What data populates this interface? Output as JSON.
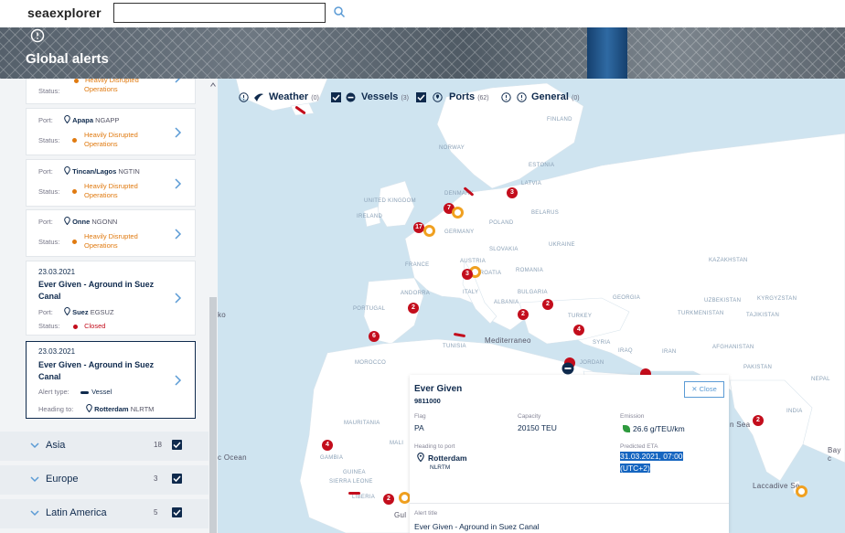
{
  "header": {
    "logo": "seaexplorer",
    "search_placeholder": ""
  },
  "hero": {
    "title": "Global alerts"
  },
  "sidebar": {
    "cards": [
      {
        "status_label": "Status:",
        "status": "Heavily Disrupted Operations"
      },
      {
        "port_label": "Port:",
        "port": "Apapa",
        "code": "NGAPP",
        "status_label": "Status:",
        "status": "Heavily Disrupted Operations"
      },
      {
        "port_label": "Port:",
        "port": "Tincan/Lagos",
        "code": "NGTIN",
        "status_label": "Status:",
        "status": "Heavily Disrupted Operations"
      },
      {
        "port_label": "Port:",
        "port": "Onne",
        "code": "NGONN",
        "status_label": "Status:",
        "status": "Heavily Disrupted Operations"
      },
      {
        "date": "23.03.2021",
        "title": "Ever Given - Aground in Suez Canal",
        "port_label": "Port:",
        "port": "Suez",
        "code": "EGSUZ",
        "status_label": "Status:",
        "status": "Closed"
      },
      {
        "date": "23.03.2021",
        "title": "Ever Given - Aground in Suez Canal",
        "alert_type_label": "Alert type:",
        "alert_type": "Vessel",
        "heading_label": "Heading to:",
        "heading": "Rotterdam",
        "heading_code": "NLRTM"
      }
    ],
    "regions": [
      {
        "name": "Asia",
        "count": "18"
      },
      {
        "name": "Europe",
        "count": "3"
      },
      {
        "name": "Latin America",
        "count": "5"
      }
    ]
  },
  "filters": [
    {
      "label": "Weather",
      "count": "(0)"
    },
    {
      "label": "Vessels",
      "count": "(3)"
    },
    {
      "label": "Ports",
      "count": "(62)"
    },
    {
      "label": "General",
      "count": "(0)"
    }
  ],
  "map": {
    "labels": {
      "finland": "FINLAND",
      "norway": "NORWAY",
      "estonia": "ESTONIA",
      "latvia": "LATVIA",
      "denmark": "DENMARK",
      "uk": "UNITED KINGDOM",
      "ireland": "IRELAND",
      "belarus": "BELARUS",
      "poland": "POLAND",
      "germany": "GERMANY",
      "ukraine": "UKRAINE",
      "slovakia": "SLOVAKIA",
      "france": "FRANCE",
      "austria": "AUSTRIA",
      "romania": "ROMANIA",
      "croatia": "CROATIA",
      "kazakhstan": "KAZAKHSTAN",
      "andorra": "ANDORRA",
      "italy": "ITALY",
      "bulgaria": "BULGARIA",
      "georgia": "GEORGIA",
      "uzbekistan": "UZBEKISTAN",
      "kyrgyzstan": "KYRGYZSTAN",
      "portugal": "PORTUGAL",
      "albania": "ALBANIA",
      "turkmenistan": "TURKMENISTAN",
      "turkey": "TURKEY",
      "tajikistan": "TAJIKISTAN",
      "tunisia": "TUNISIA",
      "mediterraneo": "Mediterraneo",
      "syria": "SYRIA",
      "iraq": "IRAQ",
      "iran": "IRAN",
      "afghanistan": "AFGHANISTAN",
      "morocco": "MOROCCO",
      "jordan": "JORDAN",
      "pakistan": "PAKISTAN",
      "nepal": "NEPAL",
      "india": "INDIA",
      "mauritania": "MAURITANIA",
      "mali": "MALI",
      "gambia": "GAMBIA",
      "guinea": "GUINEA",
      "sierra_leone": "SIERRA LEONE",
      "liberia": "LIBERIA",
      "ocean": "c Ocean",
      "sea": "n Sea",
      "bay": "Bay c",
      "laccadive": "Laccadive Se",
      "gulf": "Gul",
      "partial_ko": "ko"
    },
    "markers": [
      "3",
      "7",
      "17",
      "3",
      "2",
      "2",
      "2",
      "6",
      "4",
      "4",
      "2",
      "2"
    ]
  },
  "popup": {
    "vessel_name": "Ever Given",
    "imo": "9811000",
    "close_label": "Close",
    "flag_label": "Flag",
    "flag": "PA",
    "capacity_label": "Capacity",
    "capacity": "20150 TEU",
    "emission_label": "Emission",
    "emission": "26.6 g/TEU/km",
    "heading_label": "Heading to port",
    "heading_port": "Rotterdam",
    "heading_code": "NLRTM",
    "eta_label": "Predicted ETA",
    "eta_line1": "31.03.2021, 07:00",
    "eta_line2": "(UTC+2)",
    "alert_title_label": "Alert title",
    "alert_title": "Ever Given - Aground in Suez Canal"
  },
  "colors": {
    "navy": "#0f2a4d",
    "orange": "#e07a10",
    "red": "#c30d1c",
    "sea": "#cfe4f0",
    "land": "#ffffff"
  }
}
